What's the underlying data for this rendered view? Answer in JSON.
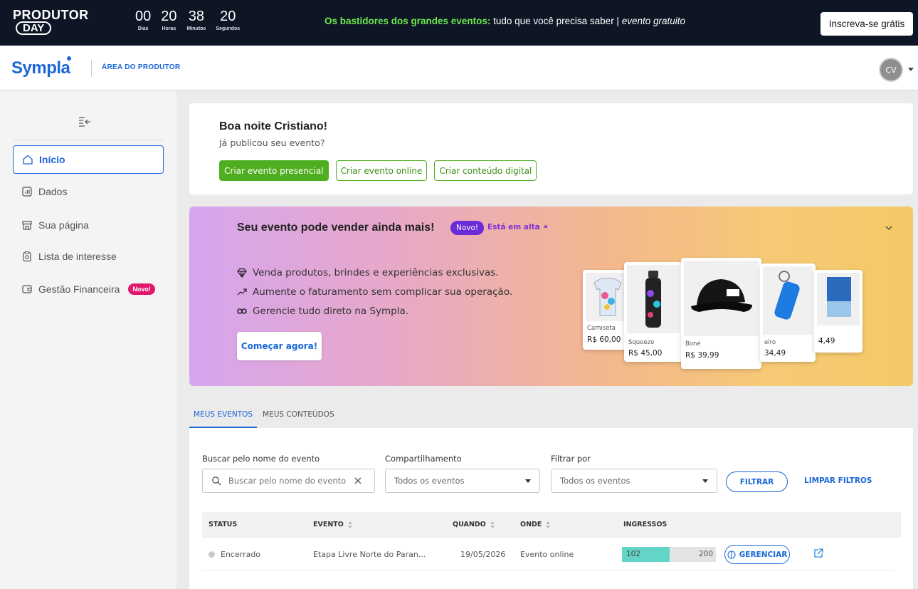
{
  "promo": {
    "logo_line1": "PRODUTOR",
    "logo_line2": "DAY",
    "countdown": [
      {
        "value": "00",
        "label": "Dias"
      },
      {
        "value": "20",
        "label": "Horas"
      },
      {
        "value": "38",
        "label": "Minutos"
      },
      {
        "value": "20",
        "label": "Segundos"
      }
    ],
    "headline_highlight": "Os bastidores dos grandes eventos:",
    "headline_text": " tudo que você precisa saber | ",
    "headline_italic": "evento gratuito",
    "cta": "Inscreva-se grátis"
  },
  "header": {
    "brand": "Sympla",
    "area": "ÁREA DO PRODUTOR",
    "avatar_initials": "CV"
  },
  "sidebar": {
    "items": [
      {
        "label": "Início",
        "icon": "home-icon",
        "active": true
      },
      {
        "label": "Dados",
        "icon": "chart-icon"
      },
      {
        "label": "Sua página",
        "icon": "storefront-icon"
      },
      {
        "label": "Lista de interesse",
        "icon": "clipboard-icon"
      },
      {
        "label": "Gestão Financeira",
        "icon": "wallet-icon",
        "badge": "Novo!"
      }
    ]
  },
  "greeting": {
    "title": "Boa noite Cristiano!",
    "subtitle": "Já publicou seu evento?",
    "buttons": [
      "Criar evento presencial",
      "Criar evento online",
      "Criar conteúdo digital"
    ]
  },
  "banner": {
    "title": "Seu evento pode vender ainda mais!",
    "badge": "Novo!",
    "trend": "Está em alta",
    "features": [
      "Venda produtos, brindes e experiências exclusivas.",
      "Aumente o faturamento sem complicar sua operação.",
      "Gerencie tudo direto na Sympla."
    ],
    "cta": "Começar agora!",
    "products": [
      {
        "name": "Camiseta",
        "price": "R$ 60,00"
      },
      {
        "name": "Squeeze",
        "price": "R$ 45,00"
      },
      {
        "name": "Boné",
        "price": "R$ 39,99"
      },
      {
        "name": "eiro",
        "price": "34,49"
      },
      {
        "name": "",
        "price": "4,49"
      }
    ]
  },
  "tabs": [
    "MEUS EVENTOS",
    "MEUS CONTEÚDOS"
  ],
  "filters": {
    "search_label": "Buscar pelo nome do evento",
    "search_placeholder": "Buscar pelo nome do evento",
    "share_label": "Compartilhamento",
    "share_value": "Todos os eventos",
    "filter_label": "Filtrar por",
    "filter_value": "Todos os eventos",
    "filter_button": "FILTRAR",
    "clear_button": "LIMPAR FILTROS"
  },
  "table": {
    "headers": [
      "STATUS",
      "EVENTO",
      "QUANDO",
      "ONDE",
      "INGRESSOS"
    ],
    "rows": [
      {
        "status": "Encerrado",
        "event": "Etapa Livre Norte do Paran...",
        "when": "19/05/2026",
        "where": "Evento online",
        "sold": 102,
        "capacity": 200,
        "manage": "GERENCIAR"
      }
    ]
  },
  "colors": {
    "primary": "#1b67d8",
    "green": "#4fae1f",
    "promo_bg": "#0e1626",
    "promo_highlight": "#6ee94c",
    "new_badge": "#e1186d",
    "ticket_fill": "#62d5c8"
  }
}
